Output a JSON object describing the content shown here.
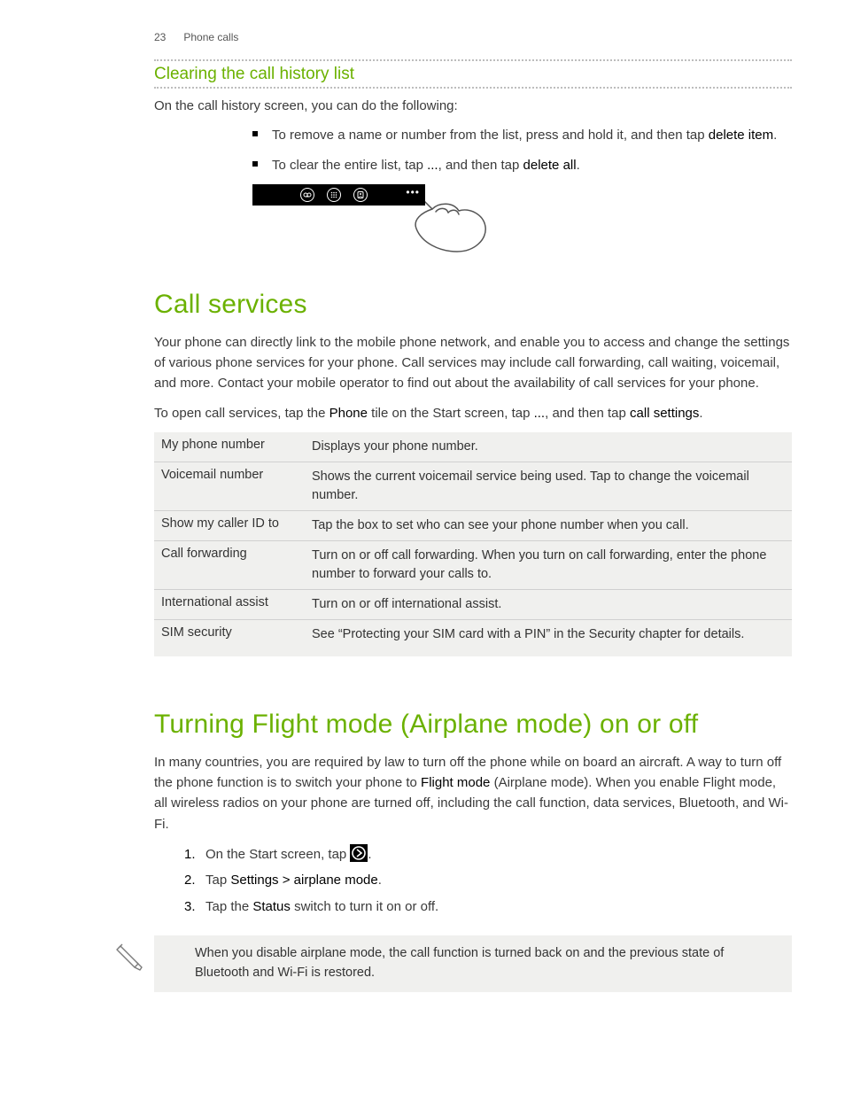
{
  "header": {
    "page_number": "23",
    "chapter": "Phone calls"
  },
  "section1": {
    "subheading": "Clearing the call history list",
    "intro": "On the call history screen, you can do the following:",
    "bullet1_pre": "To remove a name or number from the list, press and hold it, and then tap ",
    "bullet1_bold": "delete item",
    "bullet1_post": ".",
    "bullet2_pre": "To clear the entire list, tap ",
    "bullet2_mid": ", and then tap ",
    "bullet2_bold": "delete all",
    "bullet2_post": "."
  },
  "section2": {
    "title": "Call services",
    "para1": "Your phone can directly link to the mobile phone network, and enable you to access and change the settings of various phone services for your phone. Call services may include call forwarding, call waiting, voicemail, and more. Contact your mobile operator to find out about the availability of call services for your phone.",
    "para2_pre": "To open call services, tap the ",
    "para2_b1": "Phone",
    "para2_mid1": " tile on the Start screen, tap ",
    "para2_mid2": ", and then tap ",
    "para2_b2": "call settings",
    "para2_post": ".",
    "table": [
      {
        "k": "My phone number",
        "v": "Displays your phone number."
      },
      {
        "k": "Voicemail number",
        "v": "Shows the current voicemail service being used. Tap to change the voicemail number."
      },
      {
        "k": "Show my caller ID to",
        "v": "Tap the box to set who can see your phone number when you call."
      },
      {
        "k": "Call forwarding",
        "v": "Turn on or off call forwarding. When you turn on call forwarding, enter the phone number to forward your calls to."
      },
      {
        "k": "International assist",
        "v": "Turn on or off international assist."
      },
      {
        "k": "SIM security",
        "v": "See “Protecting your SIM card with a PIN” in the Security chapter for details."
      }
    ]
  },
  "section3": {
    "title": "Turning Flight mode (Airplane mode) on or off",
    "para_pre": "In many countries, you are required by law to turn off the phone while on board an aircraft. A way to turn off the phone function is to switch your phone to ",
    "para_b1": "Flight mode",
    "para_post": " (Airplane mode). When you enable Flight mode, all wireless radios on your phone are turned off, including the call function, data services, Bluetooth, and Wi-Fi.",
    "step1_pre": "On the Start screen, tap ",
    "step1_post": ".",
    "step2_pre": "Tap ",
    "step2_b": "Settings > airplane mode",
    "step2_post": ".",
    "step3_pre": "Tap the ",
    "step3_b": "Status",
    "step3_post": " switch to turn it on or off.",
    "note": "When you disable airplane mode, the call function is turned back on and the previous state of Bluetooth and Wi-Fi is restored."
  }
}
